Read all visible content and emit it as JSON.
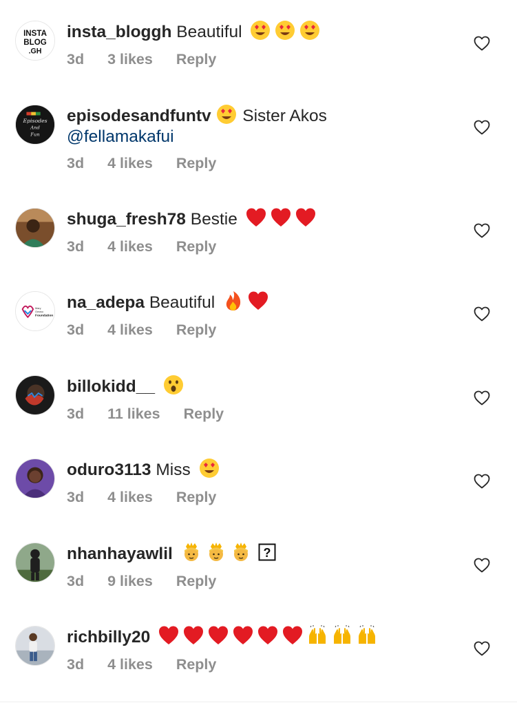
{
  "comments": [
    {
      "username": "insta_bloggh",
      "text": "Beautiful",
      "emojis": [
        "heart-eyes",
        "heart-eyes",
        "heart-eyes"
      ],
      "time": "3d",
      "likes": "3 likes",
      "reply": "Reply",
      "avatar_text": "INSTA BLOG .GH"
    },
    {
      "username": "episodesandfuntv",
      "text_after_emoji": "Sister Akos",
      "mention": "@fellamakafui",
      "emojis": [
        "heart-eyes"
      ],
      "time": "3d",
      "likes": "4 likes",
      "reply": "Reply",
      "avatar_text": "Episodes And Fun"
    },
    {
      "username": "shuga_fresh78",
      "text": "Bestie",
      "emojis": [
        "red-heart",
        "red-heart",
        "red-heart"
      ],
      "time": "3d",
      "likes": "4 likes",
      "reply": "Reply"
    },
    {
      "username": "na_adepa",
      "text": "Beautiful",
      "emojis": [
        "fire",
        "red-heart"
      ],
      "time": "3d",
      "likes": "4 likes",
      "reply": "Reply",
      "avatar_text": "Mary Foundation"
    },
    {
      "username": "billokidd__",
      "text": "",
      "emojis": [
        "hushed-face"
      ],
      "time": "3d",
      "likes": "11 likes",
      "reply": "Reply"
    },
    {
      "username": "oduro3113",
      "text": "Miss",
      "emojis": [
        "heart-eyes"
      ],
      "time": "3d",
      "likes": "4 likes",
      "reply": "Reply"
    },
    {
      "username": "nhanhayawlil",
      "text": "",
      "emojis": [
        "princess",
        "princess",
        "princess",
        "unknown-glyph"
      ],
      "time": "3d",
      "likes": "9 likes",
      "reply": "Reply"
    },
    {
      "username": "richbilly20",
      "text": "",
      "emojis": [
        "red-heart",
        "red-heart",
        "red-heart",
        "red-heart",
        "red-heart",
        "red-heart",
        "raising-hands",
        "raising-hands",
        "raising-hands"
      ],
      "time": "3d",
      "likes": "4 likes",
      "reply": "Reply"
    }
  ],
  "colors": {
    "text": "#262626",
    "meta": "#8e8e8e",
    "mention": "#00376b",
    "heart_outline": "#262626"
  },
  "icons": {
    "like": "heart-outline-icon"
  }
}
